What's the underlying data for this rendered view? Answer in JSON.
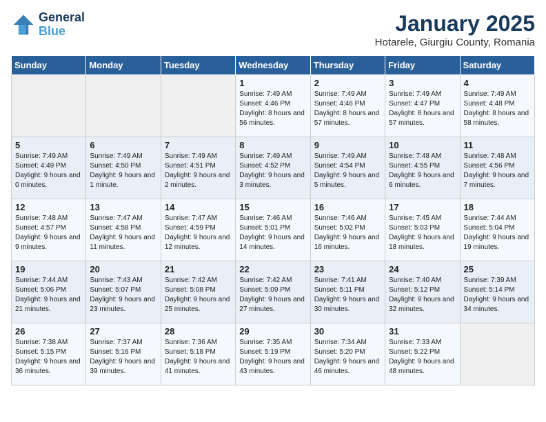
{
  "header": {
    "logo_line1": "General",
    "logo_line2": "Blue",
    "title": "January 2025",
    "subtitle": "Hotarele, Giurgiu County, Romania"
  },
  "weekdays": [
    "Sunday",
    "Monday",
    "Tuesday",
    "Wednesday",
    "Thursday",
    "Friday",
    "Saturday"
  ],
  "weeks": [
    [
      {
        "day": "",
        "info": ""
      },
      {
        "day": "",
        "info": ""
      },
      {
        "day": "",
        "info": ""
      },
      {
        "day": "1",
        "info": "Sunrise: 7:49 AM\nSunset: 4:46 PM\nDaylight: 8 hours and 56 minutes."
      },
      {
        "day": "2",
        "info": "Sunrise: 7:49 AM\nSunset: 4:46 PM\nDaylight: 8 hours and 57 minutes."
      },
      {
        "day": "3",
        "info": "Sunrise: 7:49 AM\nSunset: 4:47 PM\nDaylight: 8 hours and 57 minutes."
      },
      {
        "day": "4",
        "info": "Sunrise: 7:49 AM\nSunset: 4:48 PM\nDaylight: 8 hours and 58 minutes."
      }
    ],
    [
      {
        "day": "5",
        "info": "Sunrise: 7:49 AM\nSunset: 4:49 PM\nDaylight: 9 hours and 0 minutes."
      },
      {
        "day": "6",
        "info": "Sunrise: 7:49 AM\nSunset: 4:50 PM\nDaylight: 9 hours and 1 minute."
      },
      {
        "day": "7",
        "info": "Sunrise: 7:49 AM\nSunset: 4:51 PM\nDaylight: 9 hours and 2 minutes."
      },
      {
        "day": "8",
        "info": "Sunrise: 7:49 AM\nSunset: 4:52 PM\nDaylight: 9 hours and 3 minutes."
      },
      {
        "day": "9",
        "info": "Sunrise: 7:49 AM\nSunset: 4:54 PM\nDaylight: 9 hours and 5 minutes."
      },
      {
        "day": "10",
        "info": "Sunrise: 7:48 AM\nSunset: 4:55 PM\nDaylight: 9 hours and 6 minutes."
      },
      {
        "day": "11",
        "info": "Sunrise: 7:48 AM\nSunset: 4:56 PM\nDaylight: 9 hours and 7 minutes."
      }
    ],
    [
      {
        "day": "12",
        "info": "Sunrise: 7:48 AM\nSunset: 4:57 PM\nDaylight: 9 hours and 9 minutes."
      },
      {
        "day": "13",
        "info": "Sunrise: 7:47 AM\nSunset: 4:58 PM\nDaylight: 9 hours and 11 minutes."
      },
      {
        "day": "14",
        "info": "Sunrise: 7:47 AM\nSunset: 4:59 PM\nDaylight: 9 hours and 12 minutes."
      },
      {
        "day": "15",
        "info": "Sunrise: 7:46 AM\nSunset: 5:01 PM\nDaylight: 9 hours and 14 minutes."
      },
      {
        "day": "16",
        "info": "Sunrise: 7:46 AM\nSunset: 5:02 PM\nDaylight: 9 hours and 16 minutes."
      },
      {
        "day": "17",
        "info": "Sunrise: 7:45 AM\nSunset: 5:03 PM\nDaylight: 9 hours and 18 minutes."
      },
      {
        "day": "18",
        "info": "Sunrise: 7:44 AM\nSunset: 5:04 PM\nDaylight: 9 hours and 19 minutes."
      }
    ],
    [
      {
        "day": "19",
        "info": "Sunrise: 7:44 AM\nSunset: 5:06 PM\nDaylight: 9 hours and 21 minutes."
      },
      {
        "day": "20",
        "info": "Sunrise: 7:43 AM\nSunset: 5:07 PM\nDaylight: 9 hours and 23 minutes."
      },
      {
        "day": "21",
        "info": "Sunrise: 7:42 AM\nSunset: 5:08 PM\nDaylight: 9 hours and 25 minutes."
      },
      {
        "day": "22",
        "info": "Sunrise: 7:42 AM\nSunset: 5:09 PM\nDaylight: 9 hours and 27 minutes."
      },
      {
        "day": "23",
        "info": "Sunrise: 7:41 AM\nSunset: 5:11 PM\nDaylight: 9 hours and 30 minutes."
      },
      {
        "day": "24",
        "info": "Sunrise: 7:40 AM\nSunset: 5:12 PM\nDaylight: 9 hours and 32 minutes."
      },
      {
        "day": "25",
        "info": "Sunrise: 7:39 AM\nSunset: 5:14 PM\nDaylight: 9 hours and 34 minutes."
      }
    ],
    [
      {
        "day": "26",
        "info": "Sunrise: 7:38 AM\nSunset: 5:15 PM\nDaylight: 9 hours and 36 minutes."
      },
      {
        "day": "27",
        "info": "Sunrise: 7:37 AM\nSunset: 5:16 PM\nDaylight: 9 hours and 39 minutes."
      },
      {
        "day": "28",
        "info": "Sunrise: 7:36 AM\nSunset: 5:18 PM\nDaylight: 9 hours and 41 minutes."
      },
      {
        "day": "29",
        "info": "Sunrise: 7:35 AM\nSunset: 5:19 PM\nDaylight: 9 hours and 43 minutes."
      },
      {
        "day": "30",
        "info": "Sunrise: 7:34 AM\nSunset: 5:20 PM\nDaylight: 9 hours and 46 minutes."
      },
      {
        "day": "31",
        "info": "Sunrise: 7:33 AM\nSunset: 5:22 PM\nDaylight: 9 hours and 48 minutes."
      },
      {
        "day": "",
        "info": ""
      }
    ]
  ]
}
